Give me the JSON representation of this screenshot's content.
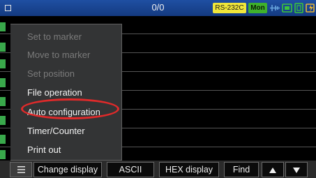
{
  "status_bar": {
    "counter": "0/0",
    "interface_badge": "RS-232C",
    "mode_badge": "Mon",
    "icons": [
      "stop-square-icon",
      "connector-icon",
      "card-icon",
      "memory-icon",
      "power-icon"
    ],
    "colors": {
      "bar": "#1a4590",
      "interface_badge": "#f0e63a",
      "mode_badge": "#3fb12c"
    }
  },
  "menu": {
    "items": [
      {
        "label": "Set to marker",
        "enabled": false
      },
      {
        "label": "Move to marker",
        "enabled": false
      },
      {
        "label": "Set position",
        "enabled": false
      },
      {
        "label": "File operation",
        "enabled": true
      },
      {
        "label": "Auto configuration",
        "enabled": true,
        "highlighted": true
      },
      {
        "label": "Timer/Counter",
        "enabled": true
      },
      {
        "label": "Print out",
        "enabled": true
      }
    ],
    "highlight_color": "#e02a2a"
  },
  "function_bar": {
    "menu_icon": "hamburger-menu-icon",
    "buttons": [
      "Change display",
      "ASCII",
      "HEX display",
      "Find"
    ],
    "scroll_up_icon": "arrow-up-icon",
    "scroll_down_icon": "arrow-down-icon"
  }
}
